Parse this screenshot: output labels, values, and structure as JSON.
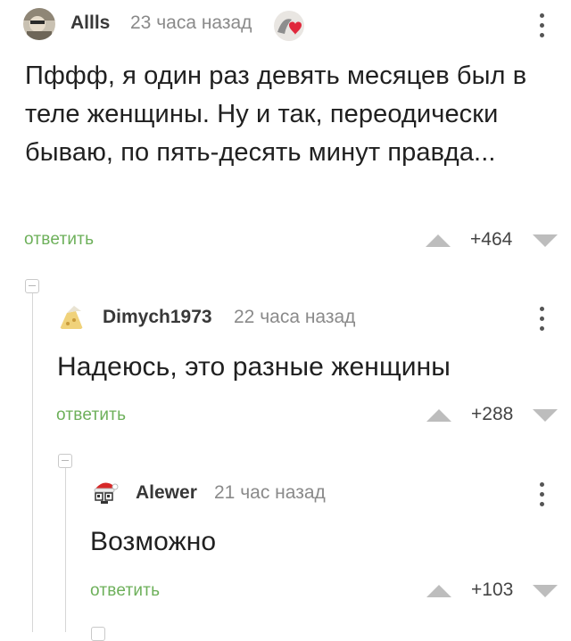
{
  "comments": [
    {
      "author": "Allls",
      "time": "23 часа назад",
      "text": "Пффф, я один раз девять месяцев был в теле женщины. Ну и так, переодически бываю, по пять-десять минут правда...",
      "reply_label": "ответить",
      "rating": "+464"
    },
    {
      "author": "Dimych1973",
      "time": "22 часа назад",
      "text": "Надеюсь, это разные женщины",
      "reply_label": "ответить",
      "rating": "+288"
    },
    {
      "author": "Alewer",
      "time": "21 час назад",
      "text": "Возможно",
      "reply_label": "ответить",
      "rating": "+103"
    }
  ],
  "colors": {
    "reply": "#6db05a",
    "thread_line": "#d6d6d6",
    "vote_arrow": "#bdbdbd"
  },
  "icons": {
    "user_avatar": "avatar-icon",
    "badge": "heart-badge-icon",
    "menu": "more-vertical-icon",
    "upvote": "upvote-arrow-icon",
    "downvote": "downvote-arrow-icon",
    "collapse": "collapse-thread-icon"
  }
}
